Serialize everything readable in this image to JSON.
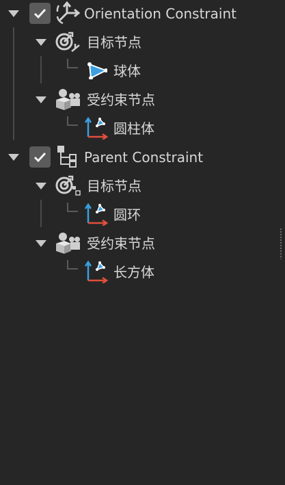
{
  "tree": {
    "constraint1": {
      "label": "Orientation Constraint",
      "target_group": {
        "label": "目标节点",
        "child": "球体"
      },
      "constrained_group": {
        "label": "受约束节点",
        "child": "圆柱体"
      }
    },
    "constraint2": {
      "label": "Parent Constraint",
      "target_group": {
        "label": "目标节点",
        "child": "圆环"
      },
      "constrained_group": {
        "label": "受约束节点",
        "child": "长方体"
      }
    }
  },
  "colors": {
    "background": "#262626",
    "accent_blue": "#3aa0e0",
    "axis_red": "#e0503c"
  }
}
